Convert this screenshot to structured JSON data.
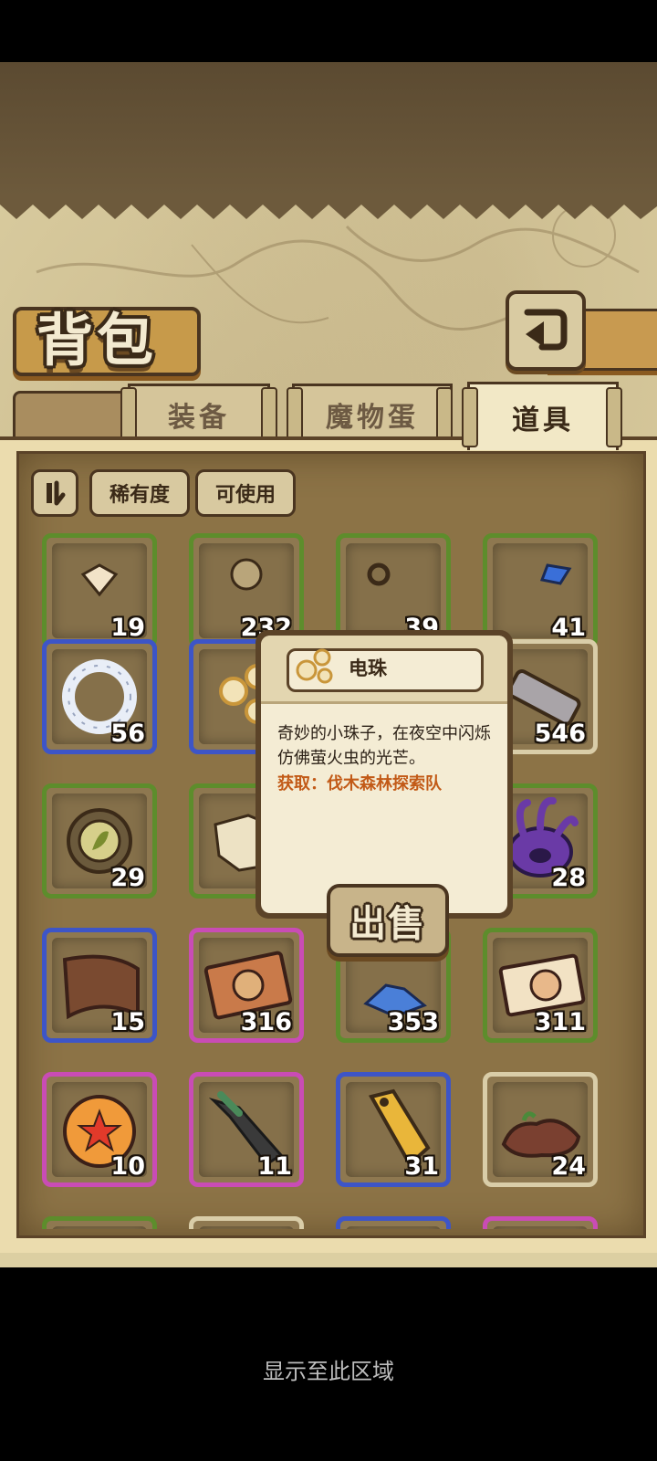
{
  "header": {
    "title": "背包",
    "back_icon": "return-arrow-icon"
  },
  "tabs": [
    {
      "label": "装备",
      "active": false
    },
    {
      "label": "魔物蛋",
      "active": false
    },
    {
      "label": "道具",
      "active": true
    }
  ],
  "filters": {
    "sort_icon": "sort-order-icon",
    "rarity_label": "稀有度",
    "usable_label": "可使用"
  },
  "items": [
    {
      "icon": "gem-item-icon",
      "count": "19",
      "frame": "green"
    },
    {
      "icon": "unknown-item-icon",
      "count": "232",
      "frame": "green"
    },
    {
      "icon": "ring-item-icon",
      "count": "39",
      "frame": "green"
    },
    {
      "icon": "blue-crystal-icon",
      "count": "41",
      "frame": "green"
    },
    {
      "icon": "pearl-bracelet-icon",
      "count": "56",
      "frame": "blue"
    },
    {
      "icon": "electric-bead-icon",
      "count": "",
      "frame": "blue"
    },
    {
      "icon": "hidden-item-icon",
      "count": "",
      "frame": "green"
    },
    {
      "icon": "stone-slab-icon",
      "count": "546",
      "frame": "tan"
    },
    {
      "icon": "leaf-medallion-icon",
      "count": "29",
      "frame": "green"
    },
    {
      "icon": "treasure-map-icon",
      "count": "",
      "frame": "green"
    },
    {
      "icon": "hidden-item-icon",
      "count": "",
      "frame": "green"
    },
    {
      "icon": "purple-tentacle-icon",
      "count": "28",
      "frame": "green"
    },
    {
      "icon": "wood-plank-icon",
      "count": "15",
      "frame": "blue"
    },
    {
      "icon": "hammer-ticket-icon",
      "count": "316",
      "frame": "pink"
    },
    {
      "icon": "ice-crystal-icon",
      "count": "353",
      "frame": "green"
    },
    {
      "icon": "character-ticket-icon",
      "count": "311",
      "frame": "green"
    },
    {
      "icon": "star-orb-icon",
      "count": "10",
      "frame": "pink"
    },
    {
      "icon": "dark-sword-icon",
      "count": "11",
      "frame": "pink"
    },
    {
      "icon": "gold-tag-icon",
      "count": "31",
      "frame": "blue"
    },
    {
      "icon": "brown-ore-icon",
      "count": "24",
      "frame": "tan"
    },
    {
      "icon": "fruit-ticket-icon",
      "count": "",
      "frame": "green"
    },
    {
      "icon": "mushroom-icon",
      "count": "",
      "frame": "tan"
    },
    {
      "icon": "gold-ore-icon",
      "count": "",
      "frame": "blue"
    },
    {
      "icon": "diamond-icon",
      "count": "",
      "frame": "pink"
    }
  ],
  "popup": {
    "name": "电珠",
    "description": "奇妙的小珠子，在夜空中闪烁仿佛萤火虫的光芒。",
    "source": "获取：伐木森林探索队",
    "sell_label": "出售"
  },
  "footer": {
    "caption": "显示至此区域"
  }
}
